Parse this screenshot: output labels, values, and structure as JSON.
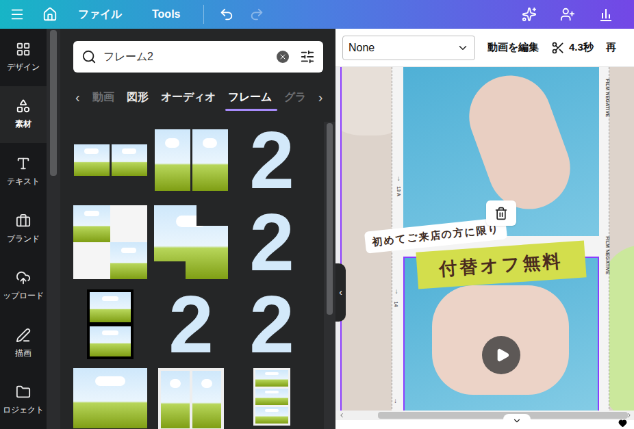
{
  "topbar": {
    "items": [
      "ファイル",
      "Tools"
    ],
    "undo_enabled": true,
    "redo_enabled": false
  },
  "sidebar": {
    "items": [
      {
        "label": "デザイン",
        "selected": false
      },
      {
        "label": "素材",
        "selected": true
      },
      {
        "label": "テキスト",
        "selected": false
      },
      {
        "label": "ブランド",
        "selected": false
      },
      {
        "label": "ップロード",
        "selected": false
      },
      {
        "label": "描画",
        "selected": false
      },
      {
        "label": "ロジェクト",
        "selected": false
      }
    ]
  },
  "search": {
    "value": "フレーム2"
  },
  "category_tabs": {
    "prev": "‹",
    "next": "›",
    "items": [
      {
        "label": "動画",
        "selected": false,
        "faded": true
      },
      {
        "label": "図形",
        "selected": false,
        "faded": false
      },
      {
        "label": "オーディオ",
        "selected": false,
        "faded": false
      },
      {
        "label": "フレーム",
        "selected": true,
        "faded": false
      },
      {
        "label": "グラ",
        "selected": false,
        "faded": true
      }
    ]
  },
  "frames": [
    {
      "kind": "double-h"
    },
    {
      "kind": "double-v"
    },
    {
      "kind": "digit",
      "glyph": "2"
    },
    {
      "kind": "quad"
    },
    {
      "kind": "stepped"
    },
    {
      "kind": "digit",
      "glyph": "2"
    },
    {
      "kind": "stack"
    },
    {
      "kind": "digit",
      "glyph": "2"
    },
    {
      "kind": "digit",
      "glyph": "2"
    },
    {
      "kind": "single"
    },
    {
      "kind": "double-bordered"
    },
    {
      "kind": "strip"
    }
  ],
  "collapse_handle": "‹",
  "toolbar": {
    "transition": "None",
    "edit_video": "動画を編集",
    "duration": "4.3秒",
    "overflow": "再"
  },
  "design": {
    "film_labels": [
      "FILM NEGATIVE",
      "FILM NEGATIVE"
    ],
    "frame_marks": [
      {
        "arrow": "↓",
        "label": "13 A"
      },
      {
        "arrow": "↓",
        "label": "14"
      },
      {
        "arrow": "↓",
        "label": ""
      }
    ],
    "tagline": "初めてご来店の方に限り",
    "headline": "付替オフ無料",
    "video_selected": true
  }
}
